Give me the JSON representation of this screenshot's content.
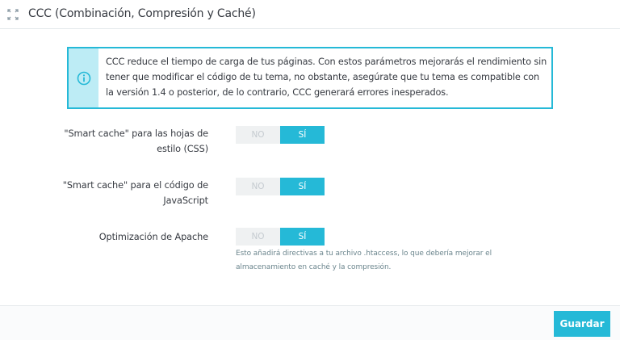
{
  "header": {
    "title": "CCC (Combinación, Compresión y Caché)",
    "icon": "expand-arrows-icon"
  },
  "alert": {
    "icon": "info-circle-icon",
    "text": "CCC reduce el tiempo de carga de tus páginas. Con estos parámetros mejorarás el rendimiento sin tener que modificar el código de tu tema, no obstante, asegúrate que tu tema es compatible con la versión 1.4 o posterior, de lo contrario, CCC generará errores inesperados."
  },
  "settings": [
    {
      "label": "\"Smart cache\" para las hojas de estilo (CSS)",
      "no": "NO",
      "yes": "SÍ",
      "value": "SÍ"
    },
    {
      "label": "\"Smart cache\" para el código de JavaScript",
      "no": "NO",
      "yes": "SÍ",
      "value": "SÍ"
    },
    {
      "label": "Optimización de Apache",
      "no": "NO",
      "yes": "SÍ",
      "value": "SÍ",
      "help": "Esto añadirá directivas a tu archivo .htaccess, lo que debería mejorar el almacenamiento en caché y la compresión."
    }
  ],
  "footer": {
    "save_label": "Guardar"
  },
  "colors": {
    "accent": "#25b9d7",
    "alert_icon_bg": "#bdecf5",
    "switch_off_bg": "#eff1f2"
  }
}
